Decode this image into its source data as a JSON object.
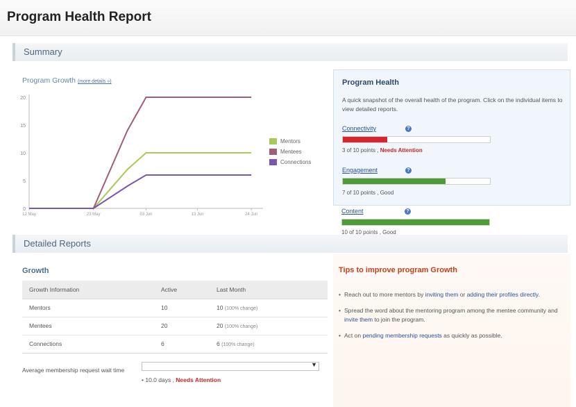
{
  "page": {
    "title": "Program Health Report"
  },
  "summary": {
    "section_label": "Summary",
    "growth_title": "Program Growth",
    "more_details": "(more details »)"
  },
  "chart_data": {
    "type": "line",
    "x": [
      "12 May",
      "23 May",
      "03 Jun",
      "13 Jun",
      "24 Jun"
    ],
    "ylim": [
      0,
      20
    ],
    "yticks": [
      "20",
      "15",
      "10",
      "5",
      "0"
    ],
    "series": [
      {
        "name": "Mentors",
        "color": "#a7c957",
        "values": [
          0,
          0,
          7,
          10,
          10,
          10
        ]
      },
      {
        "name": "Mentees",
        "color": "#a05d78",
        "values": [
          0,
          0,
          14,
          20,
          20,
          20
        ]
      },
      {
        "name": "Connections",
        "color": "#7b56b0",
        "values": [
          0,
          0,
          4,
          6,
          6,
          6
        ]
      }
    ],
    "x_points": [
      "12 May",
      "23 May",
      "30 May",
      "03 Jun",
      "13 Jun",
      "24 Jun"
    ],
    "legend": "right",
    "grid": false
  },
  "health": {
    "title": "Program Health",
    "description": "A quick snapshot of the overall health of the program. Click on the individual items to view detailed reports.",
    "metrics": [
      {
        "label": "Connectivity",
        "score": 3,
        "max": 10,
        "status_text": "3 of 10 points , ",
        "status": "Needs Attention",
        "color": "#d6262c"
      },
      {
        "label": "Engagement",
        "score": 7,
        "max": 10,
        "status_text": "7 of 10 points , Good",
        "status": "",
        "color": "#4e9a36"
      },
      {
        "label": "Content",
        "score": 10,
        "max": 10,
        "status_text": "10 of 10 points , Good",
        "status": "",
        "color": "#4e9a36"
      }
    ]
  },
  "detailed": {
    "section_label": "Detailed Reports",
    "growth_heading": "Growth",
    "table": {
      "headers": [
        "Growth Information",
        "Active",
        "Last Month"
      ],
      "rows": [
        {
          "name": "Mentors",
          "active": "10",
          "last": "10",
          "change": "(100% change)"
        },
        {
          "name": "Mentees",
          "active": "20",
          "last": "20",
          "change": "(100% change)"
        },
        {
          "name": "Connections",
          "active": "6",
          "last": "6",
          "change": "(100% change)"
        }
      ]
    },
    "avg_label": "Average membership request wait time",
    "avg_value": "• 10.0 days , ",
    "avg_status": "Needs Attention"
  },
  "tips": {
    "title": "Tips to improve program Growth",
    "items": [
      {
        "pre": "Reach out to more mentors by ",
        "link1": "inviting them",
        "mid": " or ",
        "link2": "adding their profiles directly",
        "post": "."
      },
      {
        "pre": "Spread the word about the mentoring program among the mentee community and ",
        "link1": "invite them",
        "mid": " to join the program.",
        "link2": "",
        "post": ""
      },
      {
        "pre": "Act on ",
        "link1": "pending membership requests",
        "mid": " as quickly as possible.",
        "link2": "",
        "post": ""
      }
    ]
  }
}
